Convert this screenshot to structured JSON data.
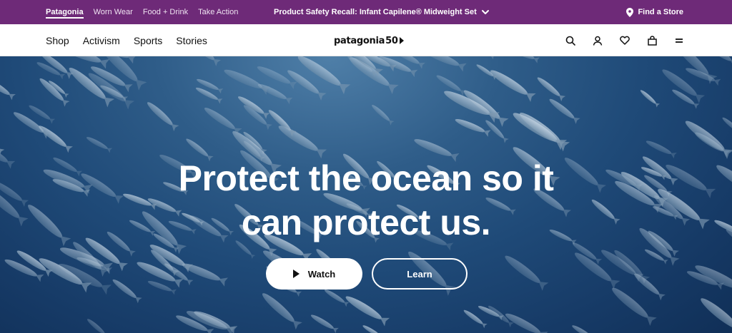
{
  "topbar": {
    "brand_links": [
      "Patagonia",
      "Worn Wear",
      "Food + Drink",
      "Take Action"
    ],
    "recall_text": "Product Safety Recall: Infant Capilene® Midweight Set",
    "store_label": "Find a Store",
    "background_color": "#6e2a78"
  },
  "nav": {
    "links": [
      "Shop",
      "Activism",
      "Sports",
      "Stories"
    ],
    "logo_text": "patagonia",
    "logo_fifty": "50",
    "icons": [
      "search-icon",
      "account-icon",
      "heart-icon",
      "bag-icon",
      "menu-icon"
    ]
  },
  "hero": {
    "headline_line1": "Protect the ocean so it",
    "headline_line2": "can protect us.",
    "watch_label": "Watch",
    "learn_label": "Learn"
  }
}
